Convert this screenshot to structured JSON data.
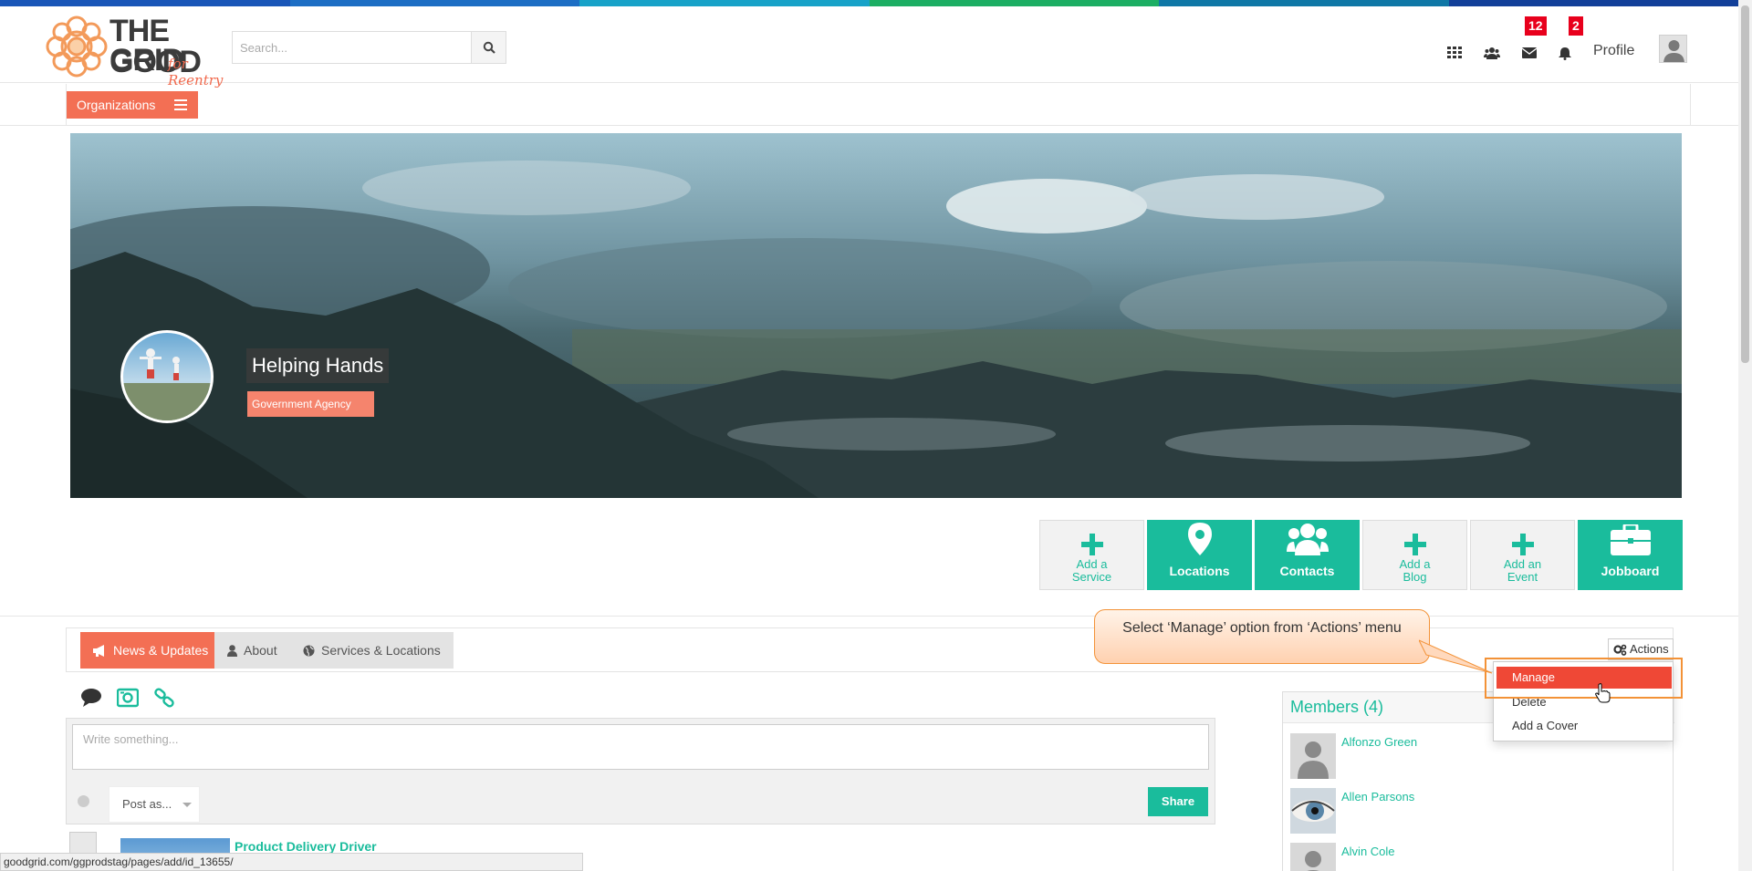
{
  "top_strip": {
    "colors": [
      "#1a56b8",
      "#1d6ec4",
      "#17a2c8",
      "#1cae63",
      "#0f77a6",
      "#123f99"
    ]
  },
  "header": {
    "logo": {
      "line1": "THE GOOD",
      "line2": "GRID",
      "tagline": "for Reentry"
    },
    "search": {
      "placeholder": "Search...",
      "icon": "search-icon"
    },
    "icons": [
      "apps-grid-icon",
      "users-icon",
      "envelope-icon",
      "bell-icon"
    ],
    "messages_badge": "12",
    "notifications_badge": "2",
    "profile_label": "Profile"
  },
  "org_bar": {
    "button_label": "Organizations"
  },
  "banner": {
    "org_name": "Helping Hands",
    "org_type": "Government Agency"
  },
  "action_tiles": [
    {
      "label_line1": "Add a",
      "label_line2": "Service",
      "icon": "plus-icon",
      "style": "light"
    },
    {
      "label_line1": "Locations",
      "label_line2": "",
      "icon": "map-marker-icon",
      "style": "teal"
    },
    {
      "label_line1": "Contacts",
      "label_line2": "",
      "icon": "users-icon",
      "style": "teal"
    },
    {
      "label_line1": "Add a",
      "label_line2": "Blog",
      "icon": "plus-icon",
      "style": "light"
    },
    {
      "label_line1": "Add an",
      "label_line2": "Event",
      "icon": "plus-icon",
      "style": "light"
    },
    {
      "label_line1": "Jobboard",
      "label_line2": "",
      "icon": "briefcase-icon",
      "style": "teal"
    }
  ],
  "tabs": [
    {
      "label": "News & Updates",
      "icon": "bullhorn-icon",
      "active": true
    },
    {
      "label": "About",
      "icon": "user-icon",
      "active": false
    },
    {
      "label": "Services & Locations",
      "icon": "globe-icon",
      "active": false
    }
  ],
  "actions": {
    "button_label": "Actions",
    "menu": [
      "Manage",
      "Delete",
      "Add a Cover"
    ],
    "highlighted": "Manage"
  },
  "callout": {
    "text": "Select ‘Manage’ option from ‘Actions’ menu"
  },
  "composer": {
    "placeholder": "Write something...",
    "post_as_label": "Post as...",
    "share_label": "Share",
    "type_icons": [
      "comment-icon",
      "photo-icon",
      "link-icon"
    ]
  },
  "feed": {
    "first_item_title": "Product Delivery Driver"
  },
  "members": {
    "title": "Members (4)",
    "list": [
      {
        "name": "Alfonzo Green"
      },
      {
        "name": "Allen Parsons"
      },
      {
        "name": "Alvin Cole"
      }
    ]
  },
  "status_bar": {
    "url": "goodgrid.com/ggprodstag/pages/add/id_13655/"
  },
  "colors": {
    "accent_orange": "#f36f54",
    "accent_teal": "#1abc9c",
    "menu_highlight": "#ef4836",
    "badge_red": "#e8001c",
    "callout_border": "#f39237"
  }
}
